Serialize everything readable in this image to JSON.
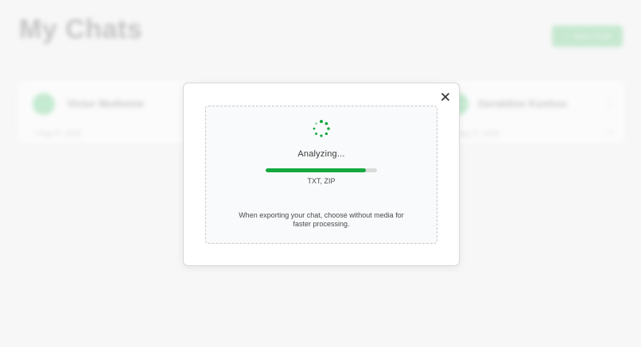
{
  "app": {
    "page_title": "My Chats",
    "new_chat_label": "New Chat"
  },
  "chats": [
    {
      "name": "Victor Mutheme",
      "date": "Aug 27, 2025"
    },
    {
      "name": "Geraldine Kunhos",
      "date": "Aug 27, 2025"
    }
  ],
  "modal": {
    "status": "Analyzing...",
    "progress_percent": 90,
    "file_types": "TXT, ZIP",
    "tip": "When exporting your chat, choose without media for faster processing."
  },
  "colors": {
    "accent": "#14a83f",
    "progress_track": "#d9d9d9"
  },
  "icons": {
    "close": "close-icon",
    "spinner": "loading-spinner-icon"
  }
}
